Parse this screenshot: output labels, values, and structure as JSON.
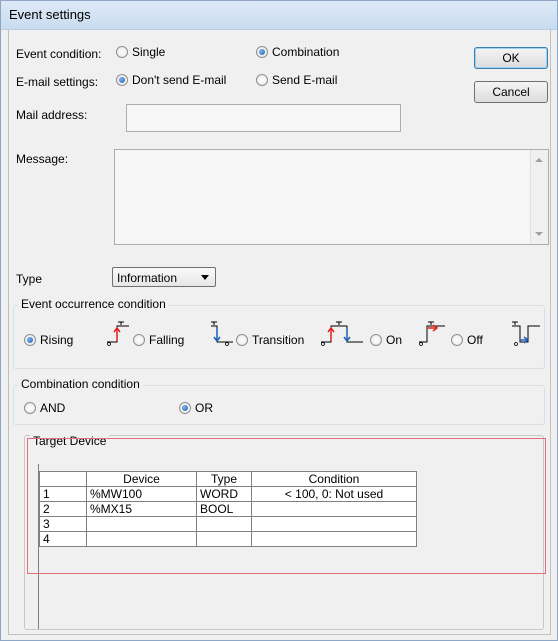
{
  "window": {
    "title": "Event settings"
  },
  "event_condition": {
    "label": "Event condition:",
    "options": [
      "Single",
      "Combination"
    ],
    "selected": "Combination"
  },
  "email_settings": {
    "label": "E-mail settings:",
    "options": [
      "Don't send E-mail",
      "Send E-mail"
    ],
    "selected": "Don't send E-mail"
  },
  "mail_address": {
    "label": "Mail address:",
    "value": ""
  },
  "message": {
    "label": "Message:",
    "value": ""
  },
  "buttons": {
    "ok": "OK",
    "cancel": "Cancel"
  },
  "type": {
    "label": "Type",
    "value": "Information"
  },
  "occurrence": {
    "legend": "Event occurrence condition",
    "options": [
      "Rising",
      "Falling",
      "Transition",
      "On",
      "Off"
    ],
    "selected": "Rising"
  },
  "combination": {
    "legend": "Combination condition",
    "options": [
      "AND",
      "OR"
    ],
    "selected": "OR"
  },
  "target": {
    "legend": "Target Device",
    "columns": [
      "",
      "Device",
      "Type",
      "Condition"
    ],
    "rows": [
      [
        "1",
        "%MW100",
        "WORD",
        "< 100, 0: Not used"
      ],
      [
        "2",
        "%MX15",
        "BOOL",
        ""
      ],
      [
        "3",
        "",
        "",
        ""
      ],
      [
        "4",
        "",
        "",
        ""
      ]
    ]
  },
  "colors": {
    "accent_red": "#e02020",
    "accent_blue": "#1c5fb0",
    "highlight": "#e0707a"
  }
}
